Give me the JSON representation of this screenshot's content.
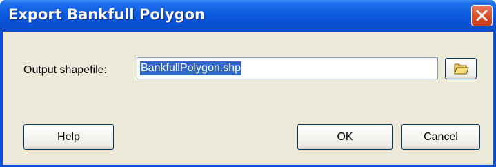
{
  "dialog": {
    "title": "Export Bankfull Polygon",
    "close_icon": "close-icon"
  },
  "form": {
    "output_label": "Output shapefile:",
    "output_value": "BankfullPolygon.shp",
    "browse_icon": "folder-icon"
  },
  "buttons": {
    "help": "Help",
    "ok": "OK",
    "cancel": "Cancel"
  },
  "colors": {
    "titlebar": "#0b5ae0",
    "close": "#d9512d",
    "client": "#ece9d8",
    "selection": "#316ac5"
  }
}
